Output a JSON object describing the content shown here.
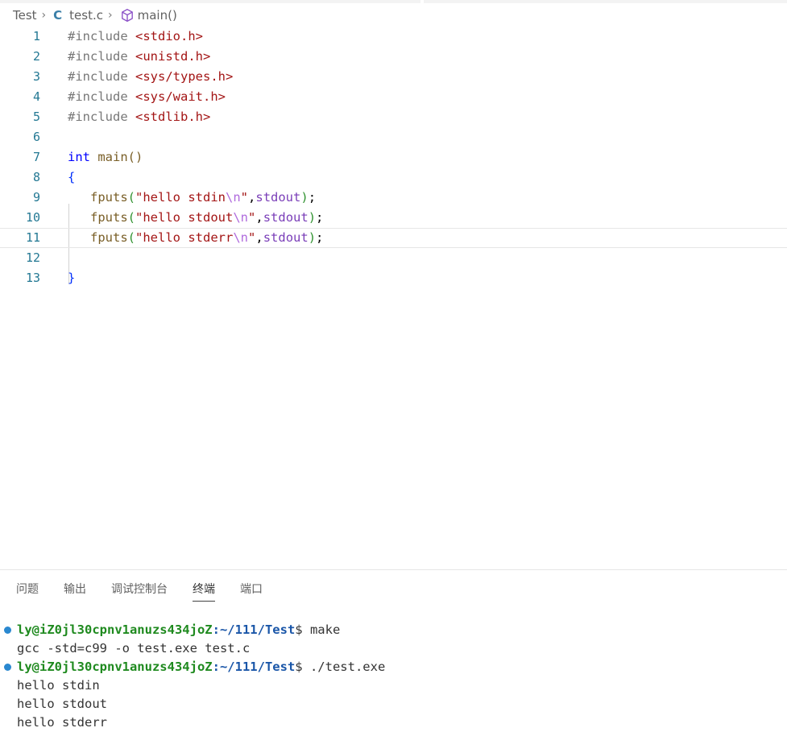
{
  "breadcrumb": {
    "folder": "Test",
    "file": "test.c",
    "file_icon": "C",
    "symbol": "main()"
  },
  "editor": {
    "line_numbers": [
      "1",
      "2",
      "3",
      "4",
      "5",
      "6",
      "7",
      "8",
      "9",
      "10",
      "11",
      "12",
      "13"
    ],
    "lines": [
      {
        "pre": "#include ",
        "hdr": "<stdio.h>"
      },
      {
        "pre": "#include ",
        "hdr": "<unistd.h>"
      },
      {
        "pre": "#include ",
        "hdr": "<sys/types.h>"
      },
      {
        "pre": "#include ",
        "hdr": "<sys/wait.h>"
      },
      {
        "pre": "#include ",
        "hdr": "<stdlib.h>"
      },
      {},
      {
        "kw": "int",
        "fn": " main()"
      },
      {
        "brace": "{"
      },
      {
        "fn": "fputs",
        "str": "\"hello stdin",
        "esc": "\\n",
        "str_end": "\"",
        "var": "stdout"
      },
      {
        "fn": "fputs",
        "str": "\"hello stdout",
        "esc": "\\n",
        "str_end": "\"",
        "var": "stdout"
      },
      {
        "fn": "fputs",
        "str": "\"hello stderr",
        "esc": "\\n",
        "str_end": "\"",
        "var": "stdout"
      },
      {},
      {
        "brace": "}"
      }
    ]
  },
  "panel": {
    "tabs": [
      "问题",
      "输出",
      "调试控制台",
      "终端",
      "端口"
    ],
    "active_tab": "终端"
  },
  "terminal": {
    "lines": [
      {
        "user": "ly@iZ0jl30cpnv1anuzs434joZ",
        "path": ":~/111/Test",
        "prompt": "$ ",
        "cmd": "make"
      },
      {
        "text": "gcc -std=c99 -o test.exe test.c"
      },
      {
        "user": "ly@iZ0jl30cpnv1anuzs434joZ",
        "path": ":~/111/Test",
        "prompt": "$ ",
        "cmd": "./test.exe"
      },
      {
        "text": "hello stdin"
      },
      {
        "text": "hello stdout"
      },
      {
        "text": "hello stderr"
      }
    ]
  },
  "colors": {
    "line_number": "#237893",
    "keyword": "#0000ff",
    "string": "#a31515",
    "terminal_user": "#1f8a1f",
    "terminal_path": "#1a56a8",
    "terminal_dot": "#2a88d0"
  }
}
